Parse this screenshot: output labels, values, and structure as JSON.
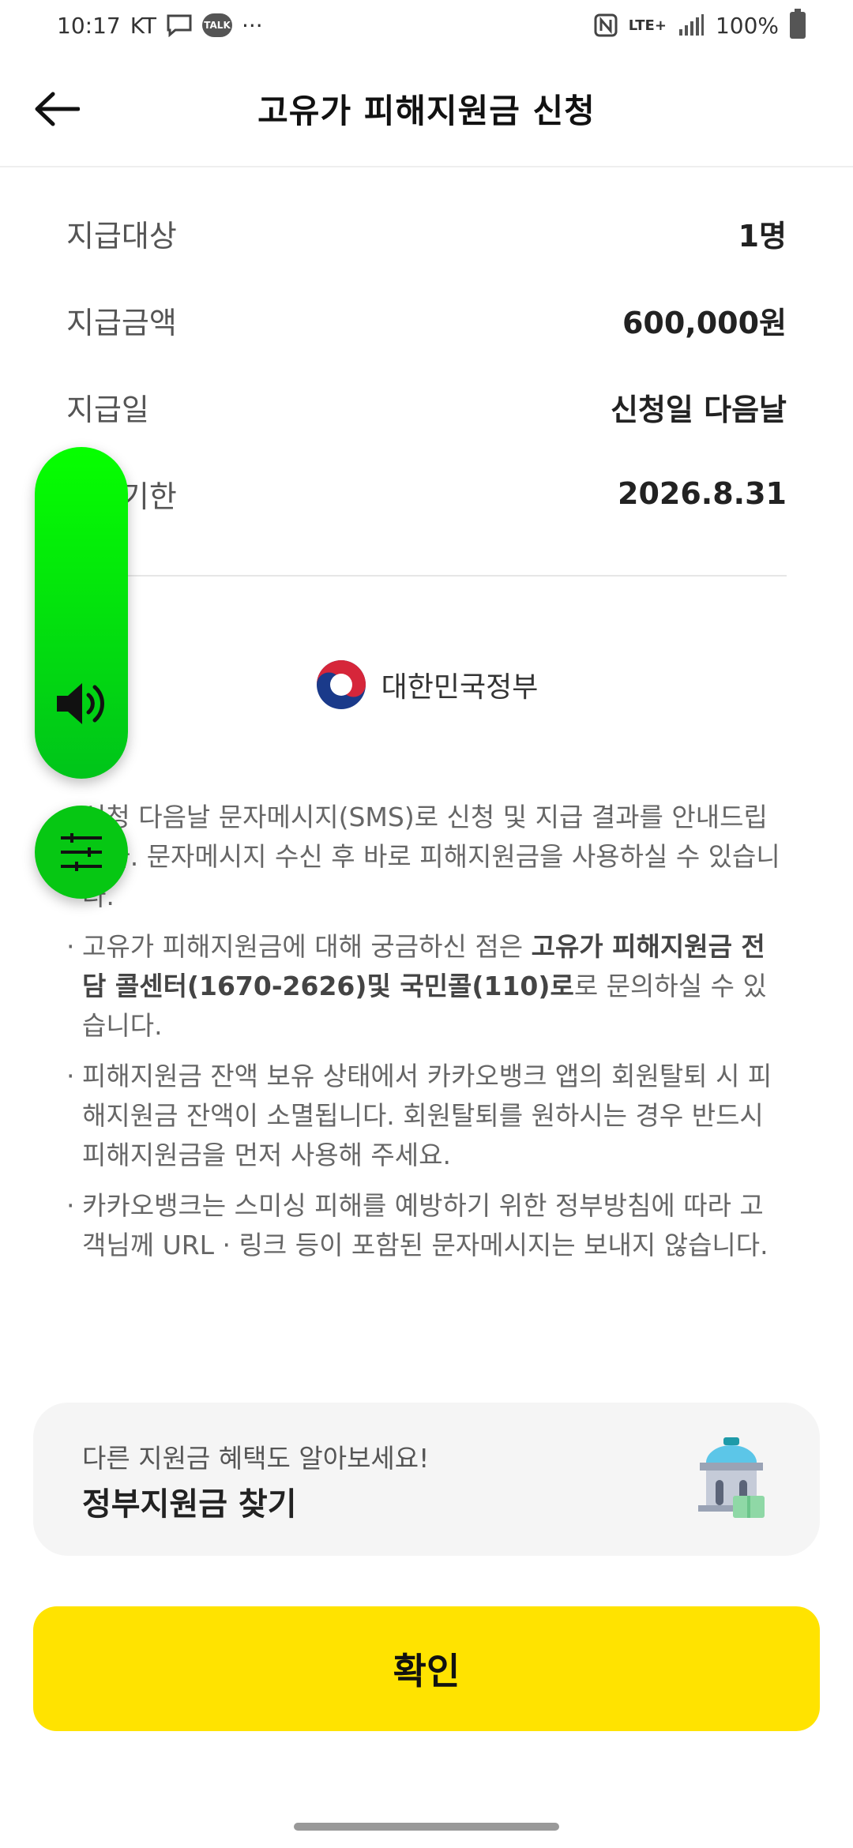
{
  "status_bar": {
    "time": "10:17",
    "carrier": "KT",
    "talk_label": "TALK",
    "more": "···",
    "network": "LTE+",
    "battery": "100%"
  },
  "header": {
    "title": "고유가 피해지원금 신청"
  },
  "info": {
    "rows": [
      {
        "label": "지급대상",
        "value": "1명"
      },
      {
        "label": "지급금액",
        "value": "600,000원"
      },
      {
        "label": "지급일",
        "value": "신청일 다음날"
      },
      {
        "label": "사용기한",
        "value": "2026.8.31"
      }
    ]
  },
  "gov_logo": {
    "text": "대한민국정부"
  },
  "notices": {
    "bullet": "·",
    "n1": "신청 다음날 문자메시지(SMS)로 신청 및 지급 결과를 안내드립니다. 문자메시지 수신 후 바로 피해지원금을 사용하실 수 있습니다.",
    "n2_a": "고유가 피해지원금에 대해 궁금하신 점은 ",
    "n2_b": "고유가 피해지원금 전담 콜센터(1670-2626)및 국민콜(110)로",
    "n2_c": "로 문의하실 수 있습니다.",
    "n3": "피해지원금 잔액 보유 상태에서 카카오뱅크 앱의 회원탈퇴 시 피해지원금 잔액이 소멸됩니다. 회원탈퇴를 원하시는 경우 반드시 피해지원금을 먼저 사용해 주세요.",
    "n4": "카카오뱅크는 스미싱 피해를 예방하기 위한 정부방침에 따라 고객님께 URL · 링크 등이 포함된 문자메시지는 보내지 않습니다."
  },
  "promo": {
    "subtitle": "다른 지원금 혜택도 알아보세요!",
    "title": "정부지원금 찾기"
  },
  "confirm": {
    "label": "확인"
  },
  "colors": {
    "confirm_bg": "#ffe300",
    "widget_green": "#06c713"
  }
}
